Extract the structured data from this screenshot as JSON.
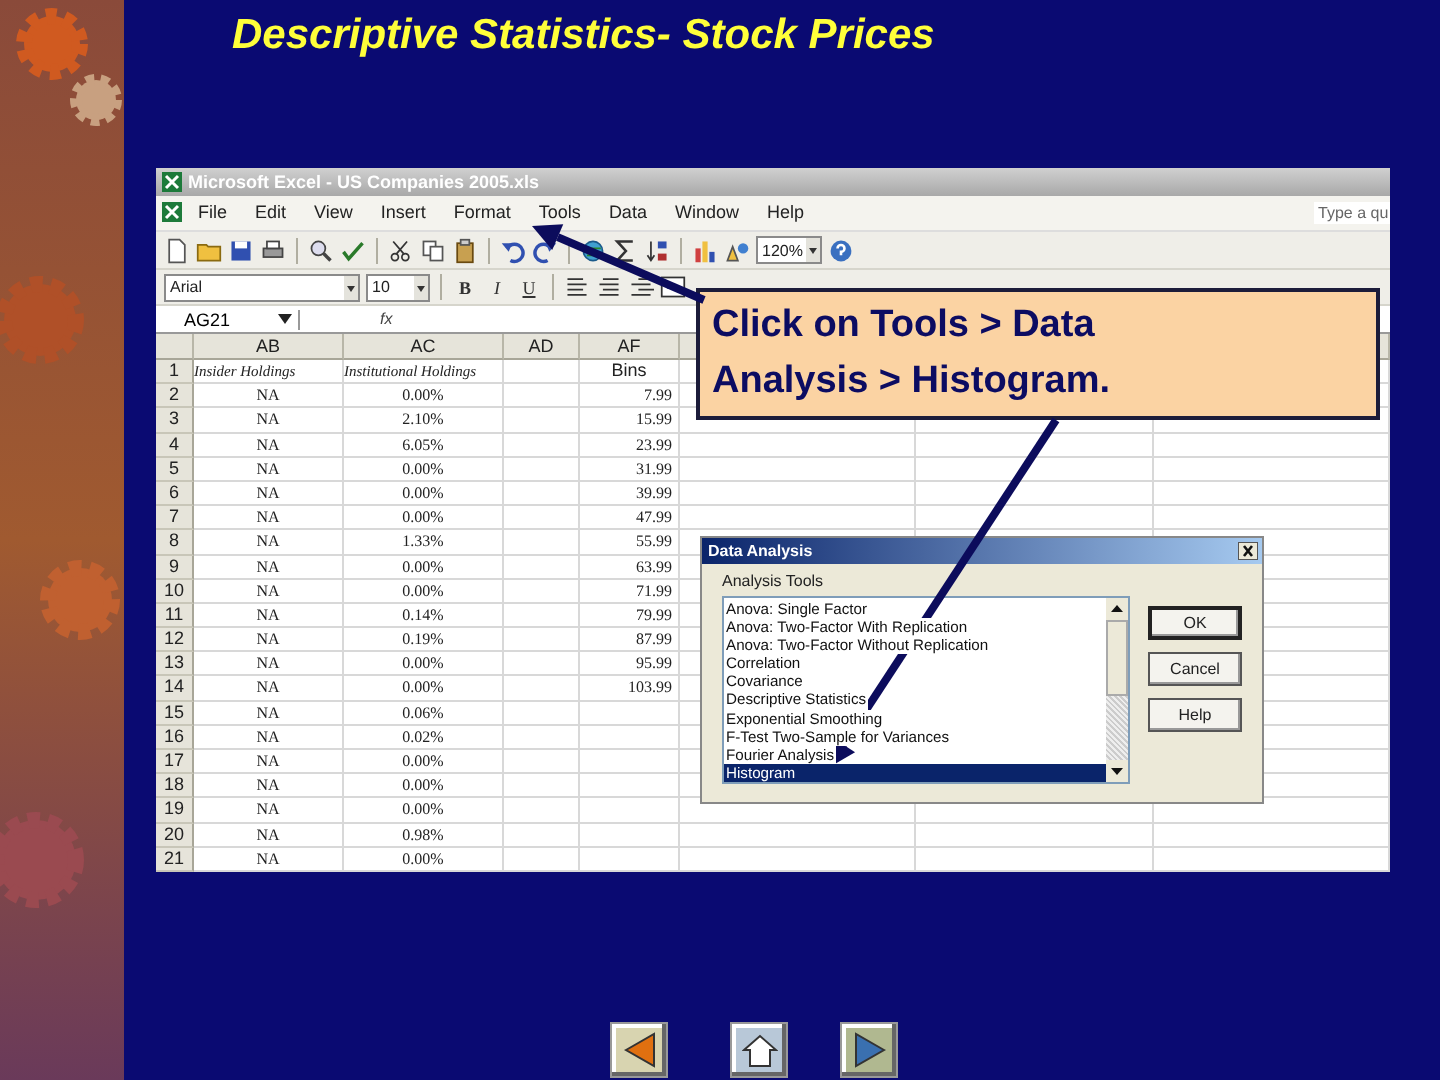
{
  "slide": {
    "title": "Descriptive Statistics- Stock Prices"
  },
  "excel": {
    "window_title": "Microsoft Excel - US Companies 2005.xls",
    "menu": [
      "File",
      "Edit",
      "View",
      "Insert",
      "Format",
      "Tools",
      "Data",
      "Window",
      "Help"
    ],
    "help_search": "Type a qu",
    "zoom": "120%",
    "font": "Arial",
    "font_size": "10",
    "format_buttons": [
      "B",
      "I",
      "U"
    ],
    "name_box": "AG21",
    "formula_label": "fx",
    "columns": [
      "AB",
      "AC",
      "AD",
      "AF"
    ],
    "rows": [
      {
        "number": "1",
        "kind": "label",
        "ab": "Insider Holdings",
        "ac": "Institutional Holdings",
        "af": "Bins"
      },
      {
        "number": "2",
        "kind": "data",
        "ab": "NA",
        "ac": "0.00%",
        "af": "7.99"
      },
      {
        "number": "3",
        "kind": "data",
        "ab": "NA",
        "ac": "2.10%",
        "af": "15.99"
      },
      {
        "number": "4",
        "kind": "data",
        "ab": "NA",
        "ac": "6.05%",
        "af": "23.99"
      },
      {
        "number": "5",
        "kind": "data",
        "ab": "NA",
        "ac": "0.00%",
        "af": "31.99"
      },
      {
        "number": "6",
        "kind": "data",
        "ab": "NA",
        "ac": "0.00%",
        "af": "39.99"
      },
      {
        "number": "7",
        "kind": "data",
        "ab": "NA",
        "ac": "0.00%",
        "af": "47.99"
      },
      {
        "number": "8",
        "kind": "data",
        "ab": "NA",
        "ac": "1.33%",
        "af": "55.99"
      },
      {
        "number": "9",
        "kind": "data",
        "ab": "NA",
        "ac": "0.00%",
        "af": "63.99"
      },
      {
        "number": "10",
        "kind": "data",
        "ab": "NA",
        "ac": "0.00%",
        "af": "71.99"
      },
      {
        "number": "11",
        "kind": "data",
        "ab": "NA",
        "ac": "0.14%",
        "af": "79.99"
      },
      {
        "number": "12",
        "kind": "data",
        "ab": "NA",
        "ac": "0.19%",
        "af": "87.99"
      },
      {
        "number": "13",
        "kind": "data",
        "ab": "NA",
        "ac": "0.00%",
        "af": "95.99"
      },
      {
        "number": "14",
        "kind": "data",
        "ab": "NA",
        "ac": "0.00%",
        "af": "103.99"
      },
      {
        "number": "15",
        "kind": "data",
        "ab": "NA",
        "ac": "0.06%"
      },
      {
        "number": "16",
        "kind": "data",
        "ab": "NA",
        "ac": "0.02%"
      },
      {
        "number": "17",
        "kind": "data",
        "ab": "NA",
        "ac": "0.00%"
      },
      {
        "number": "18",
        "kind": "data",
        "ab": "NA",
        "ac": "0.00%"
      },
      {
        "number": "19",
        "kind": "data",
        "ab": "NA",
        "ac": "0.00%"
      },
      {
        "number": "20",
        "kind": "data",
        "ab": "NA",
        "ac": "0.98%"
      },
      {
        "number": "21",
        "kind": "data",
        "ab": "NA",
        "ac": "0.00%"
      }
    ]
  },
  "callout": {
    "text": "Click on Tools > Data Analysis > Histogram."
  },
  "dialog": {
    "title": "Data Analysis",
    "group_label": "Analysis Tools",
    "tools": [
      {
        "label": "Anova: Single Factor",
        "selected": false
      },
      {
        "label": "Anova: Two-Factor With Replication",
        "selected": false
      },
      {
        "label": "Anova: Two-Factor Without Replication",
        "selected": false
      },
      {
        "label": "Correlation",
        "selected": false
      },
      {
        "label": "Covariance",
        "selected": false
      },
      {
        "label": "Descriptive Statistics",
        "selected": false
      },
      {
        "label": "Exponential Smoothing",
        "selected": false
      },
      {
        "label": "F-Test Two-Sample for Variances",
        "selected": false
      },
      {
        "label": "Fourier Analysis",
        "selected": false
      },
      {
        "label": "Histogram",
        "selected": true
      }
    ],
    "buttons": [
      "OK",
      "Cancel",
      "Help"
    ]
  },
  "nav": [
    {
      "kind": "previous"
    },
    {
      "kind": "home"
    },
    {
      "kind": "next"
    }
  ]
}
